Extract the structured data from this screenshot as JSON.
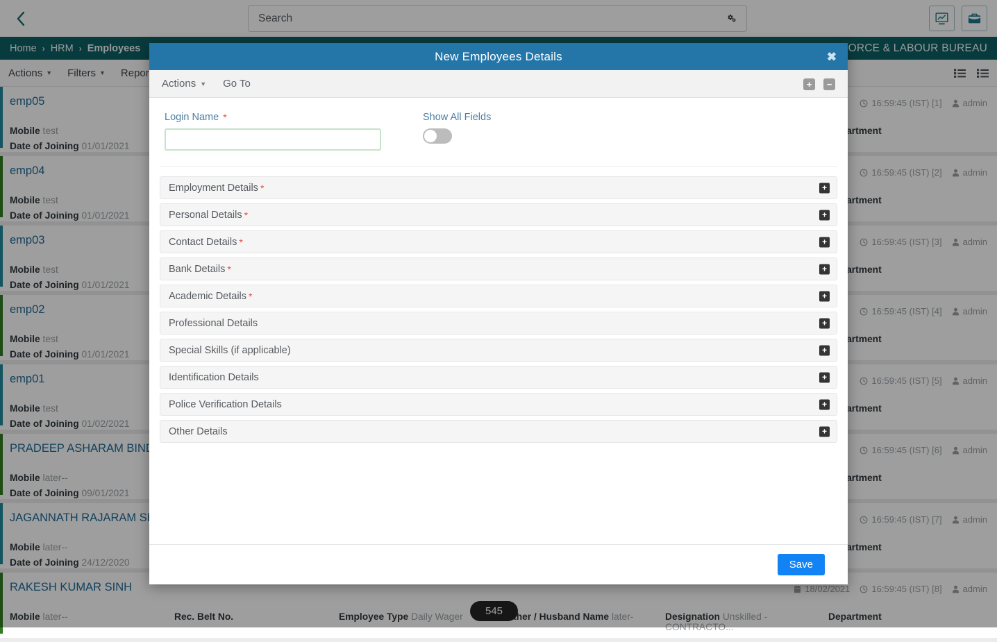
{
  "topbar": {
    "back_icon": "chevron-left-icon",
    "search": {
      "placeholder": "Search",
      "value": "",
      "settings_icon": "cogs-icon"
    },
    "right_icons": [
      {
        "name": "dashboard-monitor-icon",
        "label": "Dashboard"
      },
      {
        "name": "briefcase-icon",
        "label": "Workspace"
      }
    ]
  },
  "breadcrumb": {
    "items": [
      "Home",
      "HRM",
      "Employees"
    ],
    "separator": "›",
    "org_title": "Y FORCE & LABOUR BUREAU"
  },
  "actionbar": {
    "items": [
      {
        "label": "Actions",
        "caret": true
      },
      {
        "label": "Filters",
        "caret": true
      },
      {
        "label": "Reports",
        "caret": false
      }
    ],
    "view_icons": [
      "list-view-icon",
      "detail-view-icon"
    ]
  },
  "records": [
    {
      "name": "emp05",
      "accent": "teal",
      "mobile_label": "Mobile",
      "mobile": "test",
      "doj_label": "Date of Joining",
      "doj": "01/01/2021",
      "date": "",
      "time": "16:59:45 (IST) [1]",
      "user": "admin",
      "belt_label": "",
      "belt": "",
      "type_label": "",
      "type": "",
      "father_label": "",
      "father": "",
      "desig_label": "",
      "desig": "",
      "dept_label": "Department"
    },
    {
      "name": "emp04",
      "accent": "green",
      "mobile_label": "Mobile",
      "mobile": "test",
      "doj_label": "Date of Joining",
      "doj": "01/01/2021",
      "date": "",
      "time": "16:59:45 (IST) [2]",
      "user": "admin",
      "belt_label": "",
      "belt": "",
      "type_label": "",
      "type": "",
      "father_label": "",
      "father": "",
      "desig_label": "",
      "desig": "",
      "dept_label": "Department"
    },
    {
      "name": "emp03",
      "accent": "teal",
      "mobile_label": "Mobile",
      "mobile": "test",
      "doj_label": "Date of Joining",
      "doj": "01/01/2021",
      "date": "",
      "time": "16:59:45 (IST) [3]",
      "user": "admin",
      "belt_label": "",
      "belt": "",
      "type_label": "",
      "type": "",
      "father_label": "",
      "father": "",
      "desig_label": "",
      "desig": "",
      "dept_label": "Department"
    },
    {
      "name": "emp02",
      "accent": "green",
      "mobile_label": "Mobile",
      "mobile": "test",
      "doj_label": "Date of Joining",
      "doj": "01/01/2021",
      "date": "",
      "time": "16:59:45 (IST) [4]",
      "user": "admin",
      "belt_label": "",
      "belt": "",
      "type_label": "",
      "type": "",
      "father_label": "",
      "father": "",
      "desig_label": "",
      "desig": "",
      "dept_label": "Department"
    },
    {
      "name": "emp01",
      "accent": "teal",
      "mobile_label": "Mobile",
      "mobile": "test",
      "doj_label": "Date of Joining",
      "doj": "01/02/2021",
      "date": "",
      "time": "16:59:45 (IST) [5]",
      "user": "admin",
      "belt_label": "",
      "belt": "",
      "type_label": "",
      "type": "",
      "father_label": "",
      "father": "",
      "desig_label": "",
      "desig": "",
      "dept_label": "Department"
    },
    {
      "name": "PRADEEP ASHARAM BIND",
      "accent": "green",
      "mobile_label": "Mobile",
      "mobile": "later--",
      "doj_label": "Date of Joining",
      "doj": "09/01/2021",
      "date": "",
      "time": "16:59:45 (IST) [6]",
      "user": "admin",
      "belt_label": "",
      "belt": "",
      "type_label": "",
      "type": "",
      "father_label": "",
      "father": "",
      "desig_label": "",
      "desig": "",
      "dept_label": "Department"
    },
    {
      "name": "JAGANNATH RAJARAM SHE",
      "accent": "teal",
      "mobile_label": "Mobile",
      "mobile": "later--",
      "doj_label": "Date of Joining",
      "doj": "24/12/2020",
      "date": "",
      "time": "16:59:45 (IST) [7]",
      "user": "admin",
      "belt_label": "",
      "belt": "",
      "type_label": "",
      "type": "",
      "father_label": "",
      "father": "",
      "desig_label": "",
      "desig": "",
      "dept_label": "Department"
    },
    {
      "name": "RAKESH KUMAR SINH",
      "accent": "green",
      "mobile_label": "Mobile",
      "mobile": "later--",
      "doj_label": "Date of Joining",
      "doj": "",
      "date": "18/02/2021",
      "time": "16:59:45 (IST) [8]",
      "user": "admin",
      "belt_label": "Rec. Belt No.",
      "belt": "",
      "type_label": "Employee Type",
      "type": "Daily Wager",
      "father_label": "Father / Husband Name",
      "father": "later-",
      "desig_label": "Designation",
      "desig": "Unskilled - CONTRACTO...",
      "dept_label": "Department"
    }
  ],
  "count_badge": "545",
  "modal": {
    "title": "New Employees Details",
    "close_icon": "close-icon",
    "toolbar": {
      "actions_label": "Actions",
      "goto_label": "Go To",
      "expand_all": "+",
      "collapse_all": "−"
    },
    "login_name": {
      "label": "Login Name",
      "required": true,
      "value": "",
      "placeholder": ""
    },
    "show_all_fields": {
      "label": "Show All Fields",
      "enabled": false
    },
    "sections": [
      {
        "label": "Employment Details",
        "required": true,
        "expand_icon": "plus-icon"
      },
      {
        "label": "Personal Details",
        "required": true,
        "expand_icon": "plus-icon"
      },
      {
        "label": "Contact Details",
        "required": true,
        "expand_icon": "plus-icon"
      },
      {
        "label": "Bank Details",
        "required": true,
        "expand_icon": "plus-icon"
      },
      {
        "label": "Academic Details",
        "required": true,
        "expand_icon": "plus-icon"
      },
      {
        "label": "Professional Details",
        "required": false,
        "expand_icon": "plus-icon"
      },
      {
        "label": "Special Skills (if applicable)",
        "required": false,
        "expand_icon": "plus-icon"
      },
      {
        "label": "Identification Details",
        "required": false,
        "expand_icon": "plus-icon"
      },
      {
        "label": "Police Verification Details",
        "required": false,
        "expand_icon": "plus-icon"
      },
      {
        "label": "Other Details",
        "required": false,
        "expand_icon": "plus-icon"
      }
    ],
    "save_label": "Save"
  },
  "colors": {
    "modal_header": "#2576a8",
    "breadcrumb_bar": "#0d5f64",
    "save_button": "#1183f5",
    "accent_teal": "#1f8a9b",
    "accent_green": "#2f7d1f",
    "required_star": "#e84c3d",
    "link_text": "#1f6a96"
  }
}
